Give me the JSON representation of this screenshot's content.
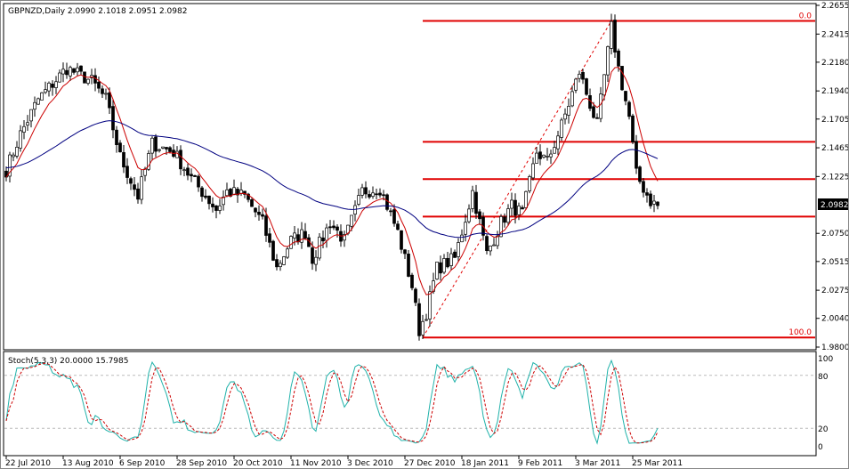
{
  "chart_data": [
    {
      "type": "candlestick",
      "title": "GBPNZD,Daily  2.0990 2.1018 2.0951 2.0982",
      "symbol": "GBPNZD",
      "timeframe": "Daily",
      "ohlc_last": {
        "open": 2.099,
        "high": 2.1018,
        "low": 2.0951,
        "close": 2.0982
      },
      "current_price_label": "2.0982",
      "ylim": [
        1.98,
        2.2655
      ],
      "y_ticks": [
        "2.2655",
        "2.2415",
        "2.2180",
        "2.1940",
        "2.1705",
        "2.1465",
        "2.1225",
        "2.0750",
        "2.0515",
        "2.0275",
        "2.0040",
        "1.9800"
      ],
      "x_ticks": [
        "22 Jul 2010",
        "13 Aug 2010",
        "6 Sep 2010",
        "28 Sep 2010",
        "20 Oct 2010",
        "11 Nov 2010",
        "3 Dec 2010",
        "27 Dec 2010",
        "18 Jan 2011",
        "9 Feb 2011",
        "3 Mar 2011",
        "25 Mar 2011"
      ],
      "bars_per_tick": 16,
      "close_path": [
        [
          0,
          2.128
        ],
        [
          4,
          2.158
        ],
        [
          9,
          2.187
        ],
        [
          17,
          2.213
        ],
        [
          24,
          2.202
        ],
        [
          28,
          2.187
        ],
        [
          32,
          2.139
        ],
        [
          37,
          2.106
        ],
        [
          41,
          2.15
        ],
        [
          47,
          2.143
        ],
        [
          52,
          2.121
        ],
        [
          59,
          2.095
        ],
        [
          62,
          2.11
        ],
        [
          67,
          2.106
        ],
        [
          72,
          2.084
        ],
        [
          76,
          2.046
        ],
        [
          80,
          2.069
        ],
        [
          84,
          2.076
        ],
        [
          86,
          2.054
        ],
        [
          91,
          2.084
        ],
        [
          95,
          2.069
        ],
        [
          100,
          2.11
        ],
        [
          105,
          2.113
        ],
        [
          110,
          2.076
        ],
        [
          114,
          2.031
        ],
        [
          116,
          1.994
        ],
        [
          118,
          2.009
        ],
        [
          121,
          2.046
        ],
        [
          126,
          2.054
        ],
        [
          131,
          2.11
        ],
        [
          135,
          2.058
        ],
        [
          139,
          2.084
        ],
        [
          142,
          2.098
        ],
        [
          145,
          2.091
        ],
        [
          149,
          2.143
        ],
        [
          152,
          2.135
        ],
        [
          156,
          2.165
        ],
        [
          161,
          2.21
        ],
        [
          166,
          2.165
        ],
        [
          170,
          2.247
        ],
        [
          172,
          2.213
        ],
        [
          175,
          2.172
        ],
        [
          177,
          2.124
        ],
        [
          181,
          2.102
        ],
        [
          183,
          2.098
        ]
      ],
      "moving_averages": [
        {
          "name": "fast MA",
          "color": "#cc0000"
        },
        {
          "name": "slow MA",
          "color": "#000080"
        }
      ],
      "fibonacci": {
        "from_bar": 117,
        "to_bar": 170,
        "high": 2.2525,
        "low": 1.988,
        "levels": [
          {
            "label": "0.0",
            "value": 2.2525
          },
          {
            "label": "",
            "value": 2.1515
          },
          {
            "label": "",
            "value": 2.1203
          },
          {
            "label": "",
            "value": 2.089
          },
          {
            "label": "100.0",
            "value": 1.988
          }
        ],
        "color": "#e00000"
      }
    },
    {
      "type": "line",
      "title": "Stoch(5,3,3) 20.0000 15.7985",
      "params": "5,3,3",
      "main_value": 20.0,
      "signal_value": 15.7985,
      "ylim": [
        0,
        100
      ],
      "y_ticks": [
        "100",
        "80",
        "20",
        "0"
      ],
      "levels": [
        80,
        20
      ],
      "series": [
        {
          "name": "%K",
          "color": "#20b2aa"
        },
        {
          "name": "%D",
          "color": "#cc0000",
          "style": "dashed"
        }
      ]
    }
  ]
}
